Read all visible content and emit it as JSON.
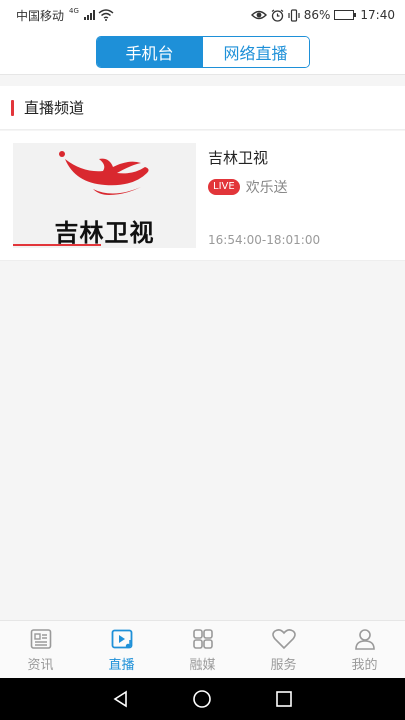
{
  "status_bar": {
    "carrier": "中国移动",
    "network": "4G",
    "battery": "86%",
    "battery_level": 0.86,
    "time": "17:40"
  },
  "header": {
    "tabs": [
      {
        "label": "手机台",
        "active": true
      },
      {
        "label": "网络直播",
        "active": false
      }
    ]
  },
  "section": {
    "title": "直播频道",
    "accent_color": "#e2353a"
  },
  "channel": {
    "name": "吉林卫视",
    "thumbnail_text": "吉林卫视",
    "live_badge": "LIVE",
    "program": "欢乐送",
    "time_range": "16:54:00-18:01:00"
  },
  "tabbar": {
    "items": [
      {
        "label": "资讯",
        "icon": "news-icon",
        "active": false
      },
      {
        "label": "直播",
        "icon": "live-play-icon",
        "active": true
      },
      {
        "label": "融媒",
        "icon": "grid-icon",
        "active": false
      },
      {
        "label": "服务",
        "icon": "heart-icon",
        "active": false
      },
      {
        "label": "我的",
        "icon": "user-icon",
        "active": false
      }
    ]
  },
  "colors": {
    "primary": "#1e90d8",
    "live_red": "#e2353a",
    "inactive": "#9a9a9a"
  }
}
